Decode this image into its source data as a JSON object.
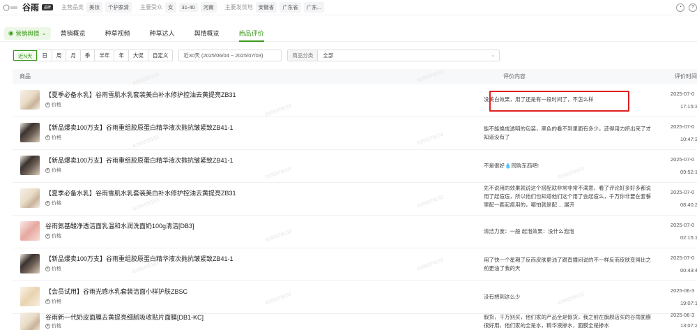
{
  "topbar": {
    "logo_text": "谷雨",
    "brand_name": "谷雨",
    "brand_badge": "品牌",
    "main_category_label": "主营品类",
    "main_categories": [
      "美妆",
      "个护家清"
    ],
    "audience_label": "主要受众",
    "audience_tags": [
      "女",
      "31-40",
      "河南"
    ],
    "shipping_label": "主要发货地",
    "shipping_tags": [
      "安徽省",
      "广东省",
      "广东..."
    ]
  },
  "nav": {
    "dropdown_label": "营销舆情",
    "tabs": [
      "营销概览",
      "种草视频",
      "种草达人",
      "舆情概览",
      "商品评价"
    ],
    "active_tab": "商品评价"
  },
  "filters": {
    "periods": [
      "近N天",
      "日",
      "周",
      "月",
      "季",
      "半年",
      "年",
      "大促",
      "自定义"
    ],
    "active_period": "近N天",
    "date_range": "近30天 (2025/06/04 ~ 2025/07/03)",
    "category_label": "商品分类",
    "category_value": "全部"
  },
  "table": {
    "headers": {
      "product": "商品",
      "review": "评价内容",
      "time": "评价时间"
    },
    "price_label": "价格",
    "rows": [
      {
        "title": "【夏季必备水乳】谷雨雪肌水乳套装美白补水修护控油去黄提亮ZB31",
        "review": "没美白效果，用了还是有一段时间了，不怎么样",
        "date": "2025-07-0",
        "time": "17:15:3"
      },
      {
        "title": "【新品爆卖100万支】谷雨重组胶原蛋白精华液次抛抗皱紧致ZB41-1",
        "review": "能不能换成透明的包装，黑色的看不到里面有多少，还得用力挤出来了才知道没有了",
        "date": "2025-07-0",
        "time": "10:47:3"
      },
      {
        "title": "【新品爆卖100万支】谷雨重组胶原蛋白精华液次抛抗皱紧致ZB41-1",
        "review": "不是很好💧同购东西吧!",
        "date": "2025-07-0",
        "time": "09:52:1"
      },
      {
        "title": "【夏季必备水乳】谷雨雪肌水乳套装美白补水修护控油去黄提亮ZB31",
        "review": "先不说用的效果就说这个搭配就非常非常不满意，看了评论好多好多都说用了起痘痘，所以他们也知道他们这个用了会起痘么，千万你非要在套餐里配一套起痘用的，哪怕就是配 ... 展开",
        "date": "2025-07-0",
        "time": "08:40:2"
      },
      {
        "title": "谷雨氨基酸净透洁面乳温和水润洗面奶100g清洁[DB3]",
        "review": "清洁力度：一般 起泡效果：没什么泡泡",
        "date": "2025-07-0",
        "time": "02:15:1"
      },
      {
        "title": "【新品爆卖100万支】谷雨重组胶原蛋白精华液次抛抗皱紧致ZB41-1",
        "review": "用了快一个星期了反而皮肤更油了跟直播间说的不一样反而皮肤变得比之前更油了我的天",
        "date": "2025-07-0",
        "time": "00:43:4"
      },
      {
        "title": "【会员试用】谷雨光感水乳套装洁面小样护肤ZBSC",
        "review": "没有想到这么少",
        "date": "2025-06-3",
        "time": "19:07:1"
      },
      {
        "title": "谷雨新一代奶皮面膜去黄提亮细腻吸收贴片面膜[DB1-KC]",
        "review": "假货，千万别买，他们家的产品全是假货，我之前在旗舰店买的谷雨面膜很好用，他们家的全是水，精华液掺水，面膜全是掺水",
        "date": "2025-06-3",
        "time": "13:07:2"
      }
    ]
  },
  "watermark_text": "8155379153",
  "colors": {
    "accent": "#3a9a1a",
    "highlight": "#e02020"
  },
  "icons": {
    "top_right": [
      "clock-icon",
      "help-icon"
    ],
    "price": "price-tag-icon",
    "dropdown": "chevron-down-icon"
  }
}
